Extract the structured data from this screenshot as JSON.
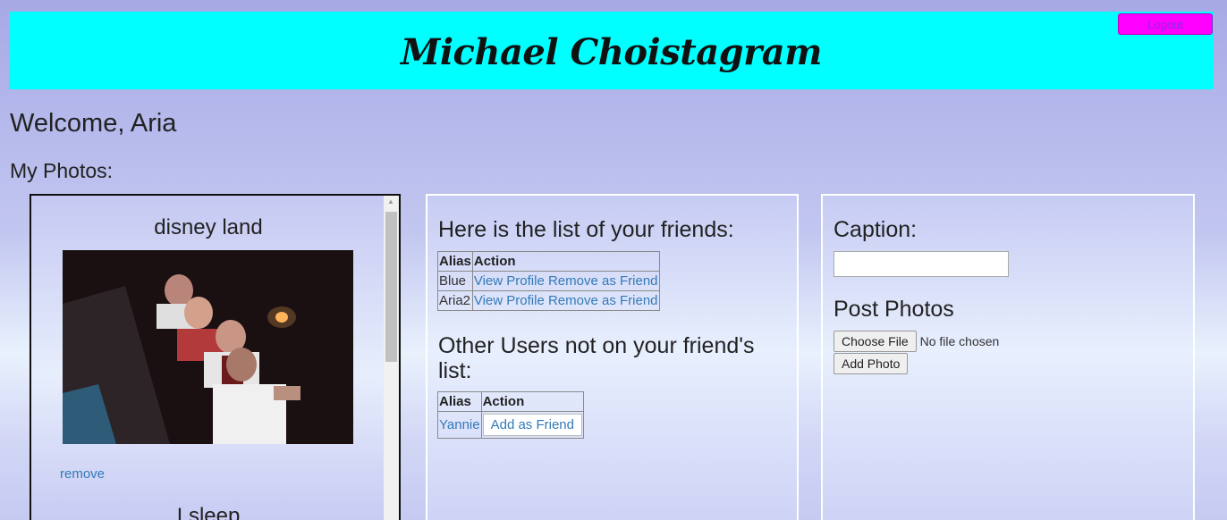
{
  "header": {
    "title": "Michael Choistagram",
    "logout_label": "Logout"
  },
  "welcome": "Welcome, Aria",
  "my_photos_heading": "My Photos:",
  "photos": [
    {
      "caption": "disney land",
      "remove_label": "remove"
    },
    {
      "caption": "I sleep"
    }
  ],
  "friends": {
    "heading": "Here is the list of your friends:",
    "columns": [
      "Alias",
      "Action"
    ],
    "rows": [
      {
        "alias": "Blue",
        "view_label": "View Profile",
        "remove_label": "Remove as Friend"
      },
      {
        "alias": "Aria2",
        "view_label": "View Profile",
        "remove_label": "Remove as Friend"
      }
    ]
  },
  "others": {
    "heading": "Other Users not on your friend's list:",
    "columns": [
      "Alias",
      "Action"
    ],
    "rows": [
      {
        "alias": "Yannie",
        "add_label": "Add as Friend"
      }
    ]
  },
  "post": {
    "caption_label": "Caption:",
    "caption_value": "",
    "post_heading": "Post Photos",
    "choose_file_label": "Choose File",
    "no_file_text": "No file chosen",
    "add_photo_label": "Add Photo"
  },
  "colors": {
    "header_bg": "#00ffff",
    "logout_bg": "#ff00ff",
    "link": "#337ab7"
  }
}
